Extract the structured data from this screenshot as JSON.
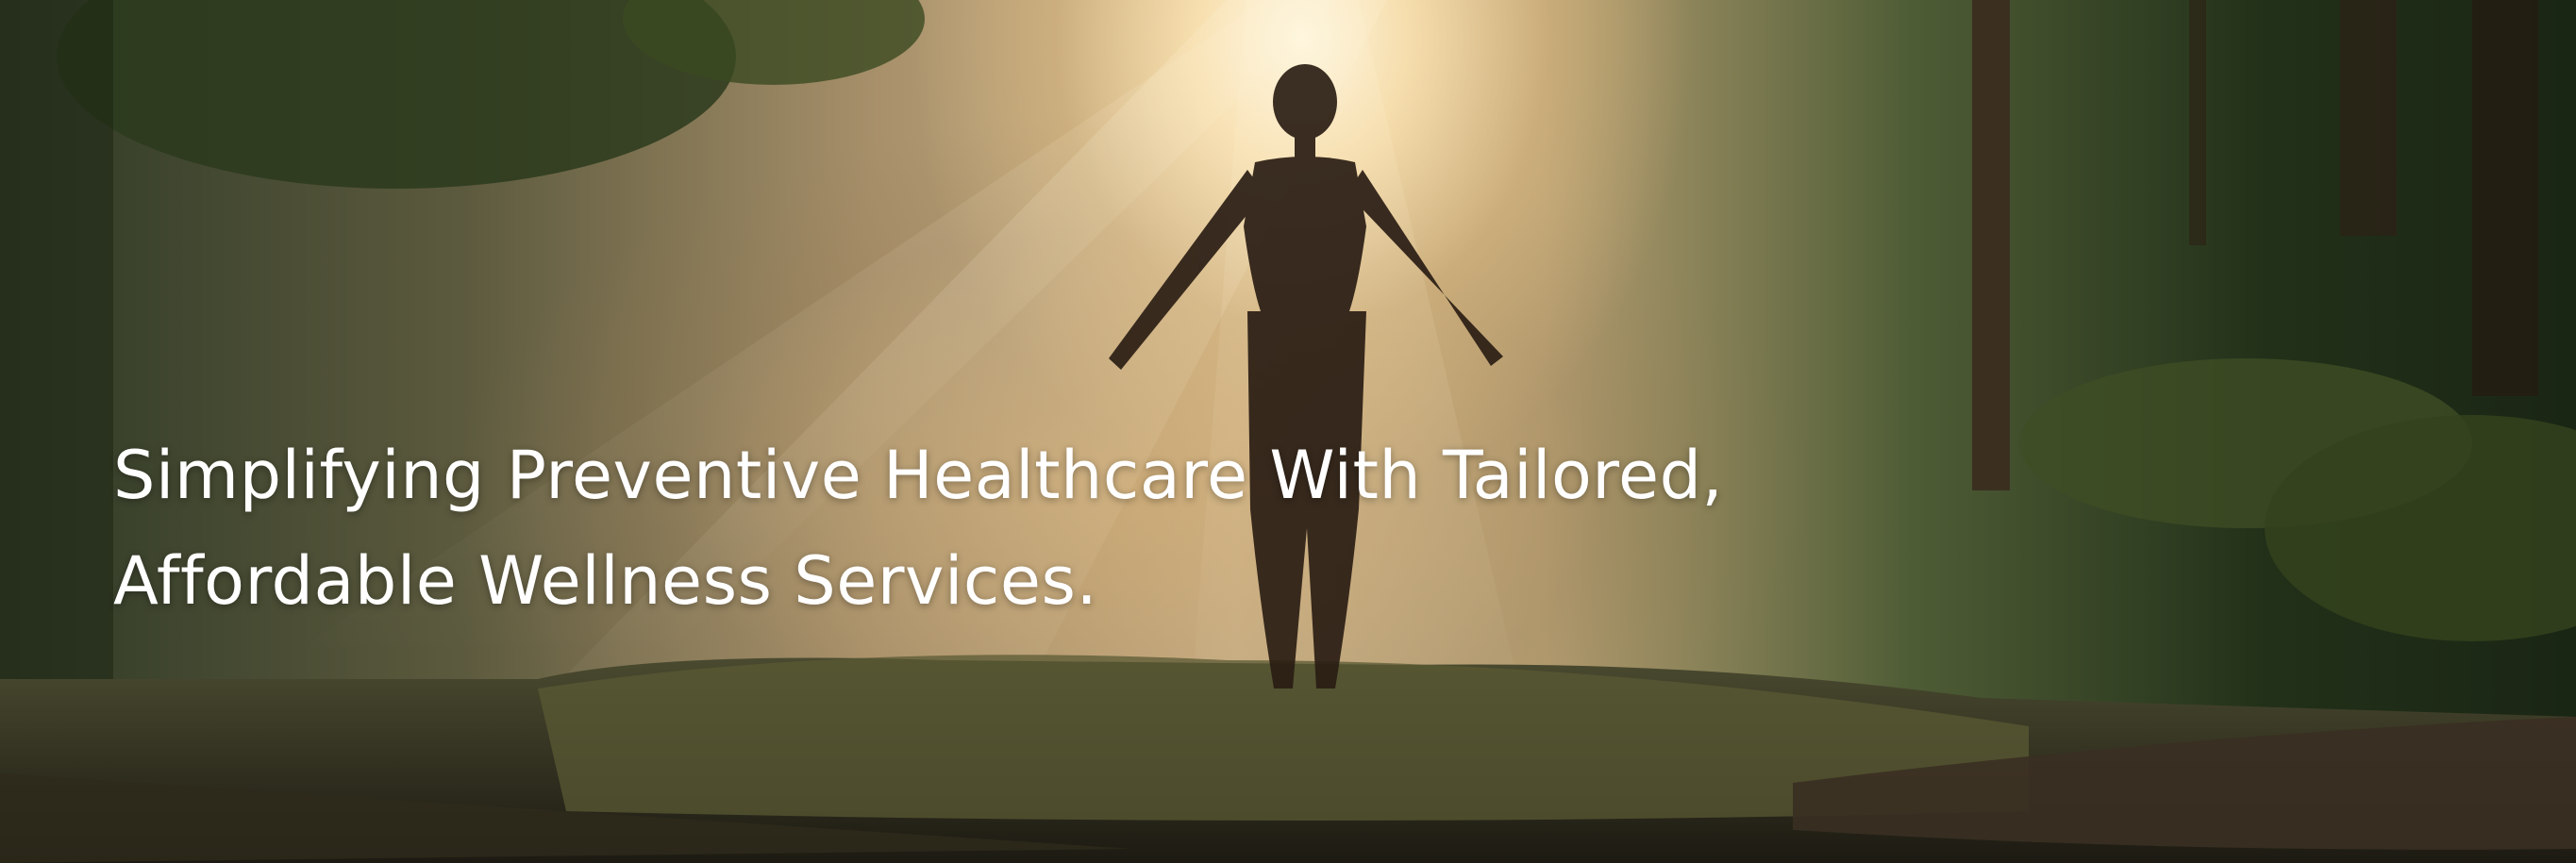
{
  "hero": {
    "headline_line1": "Simplifying Preventive Healthcare With Tailored,",
    "headline_line2": "Affordable Wellness Services."
  }
}
